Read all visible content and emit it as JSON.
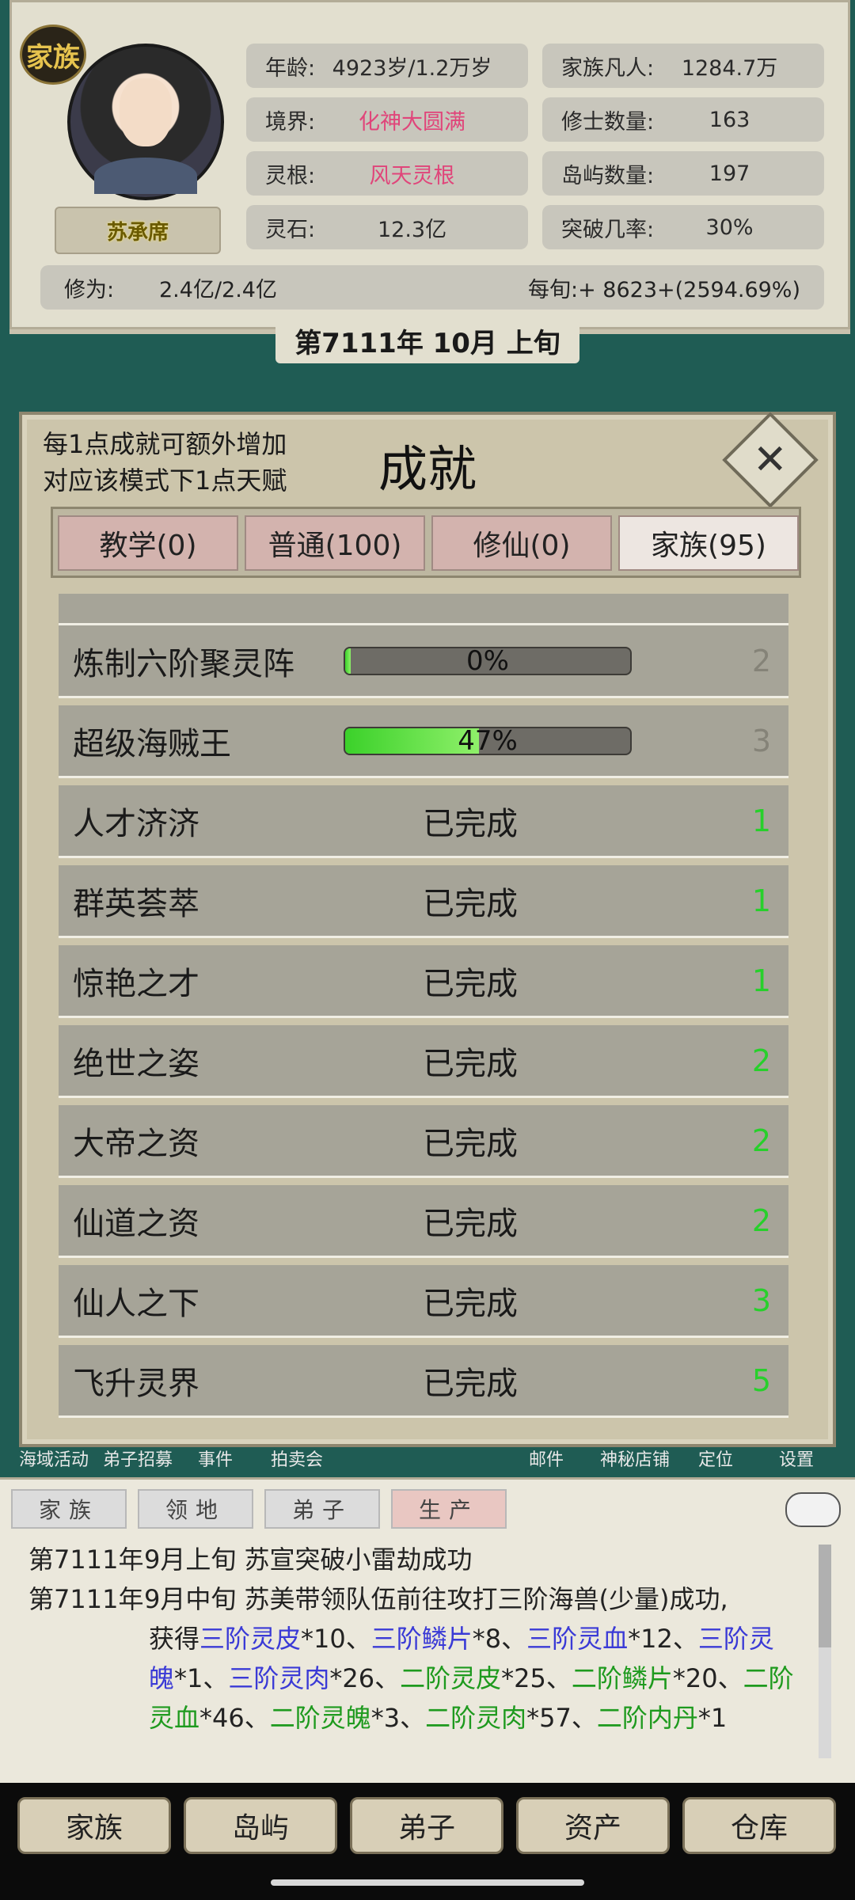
{
  "header": {
    "clan_badge": "家族",
    "character_name": "苏承席",
    "stats_left": [
      {
        "label": "年龄:",
        "value": "4923岁/1.2万岁",
        "highlight": false
      },
      {
        "label": "境界:",
        "value": "化神大圆满",
        "highlight": true
      },
      {
        "label": "灵根:",
        "value": "风天灵根",
        "highlight": true
      },
      {
        "label": "灵石:",
        "value": "12.3亿",
        "highlight": false
      }
    ],
    "stats_right": [
      {
        "label": "家族凡人:",
        "value": "1284.7万"
      },
      {
        "label": "修士数量:",
        "value": "163"
      },
      {
        "label": "岛屿数量:",
        "value": "197"
      },
      {
        "label": "突破几率:",
        "value": "30%"
      }
    ],
    "cultivation_label": "修为:",
    "cultivation_value": "2.4亿/2.4亿",
    "per_period": "每旬:+ 8623+(2594.69%)",
    "date": "第7111年 10月 上旬"
  },
  "dialog": {
    "hint_line1": "每1点成就可额外增加",
    "hint_line2": "对应该模式下1点天赋",
    "title": "成就",
    "tabs": [
      {
        "label": "教学(0)",
        "active": false
      },
      {
        "label": "普通(100)",
        "active": false
      },
      {
        "label": "修仙(0)",
        "active": false
      },
      {
        "label": "家族(95)",
        "active": true
      }
    ],
    "achievements": [
      {
        "name": "炼制六阶聚灵阵",
        "progress": 0,
        "progress_text": "0%",
        "points": "2",
        "done": false
      },
      {
        "name": "超级海贼王",
        "progress": 47,
        "progress_text": "47%",
        "points": "3",
        "done": false
      },
      {
        "name": "人才济济",
        "status": "已完成",
        "points": "1",
        "done": true
      },
      {
        "name": "群英荟萃",
        "status": "已完成",
        "points": "1",
        "done": true
      },
      {
        "name": "惊艳之才",
        "status": "已完成",
        "points": "1",
        "done": true
      },
      {
        "name": "绝世之姿",
        "status": "已完成",
        "points": "2",
        "done": true
      },
      {
        "name": "大帝之资",
        "status": "已完成",
        "points": "2",
        "done": true
      },
      {
        "name": "仙道之资",
        "status": "已完成",
        "points": "2",
        "done": true
      },
      {
        "name": "仙人之下",
        "status": "已完成",
        "points": "3",
        "done": true
      },
      {
        "name": "飞升灵界",
        "status": "已完成",
        "points": "5",
        "done": true
      }
    ]
  },
  "menu_strip": [
    "海域活动",
    "弟子招募",
    "事件",
    "拍卖会",
    "邮件",
    "神秘店铺",
    "定位",
    "设置"
  ],
  "log": {
    "tabs": [
      {
        "label": "家族",
        "active": false
      },
      {
        "label": "领地",
        "active": false
      },
      {
        "label": "弟子",
        "active": false
      },
      {
        "label": "生产",
        "active": true
      }
    ],
    "line1_date": "第7111年",
    "line1_text": "9月上旬 苏宣突破小雷劫成功",
    "line2_date": "第7111年",
    "line2_text": "9月中旬 苏美带领队伍前往攻打三阶海兽(少量)成功,",
    "line2_cont_prefix": "获得",
    "items": [
      {
        "name": "三阶灵皮",
        "qty": "*10",
        "tier": 3
      },
      {
        "name": "三阶鳞片",
        "qty": "*8",
        "tier": 3
      },
      {
        "name": "三阶灵血",
        "qty": "*12",
        "tier": 3
      },
      {
        "name": "三阶灵魄",
        "qty": "*1",
        "tier": 3
      },
      {
        "name": "三阶灵肉",
        "qty": "*26",
        "tier": 3
      },
      {
        "name": "二阶灵皮",
        "qty": "*25",
        "tier": 2
      },
      {
        "name": "二阶鳞片",
        "qty": "*20",
        "tier": 2
      },
      {
        "name": "二阶灵血",
        "qty": "*46",
        "tier": 2
      },
      {
        "name": "二阶灵魄",
        "qty": "*3",
        "tier": 2
      },
      {
        "name": "二阶灵肉",
        "qty": "*57",
        "tier": 2
      },
      {
        "name": "二阶内丹",
        "qty": "*1",
        "tier": 2
      }
    ]
  },
  "bottom_nav": [
    "家族",
    "岛屿",
    "弟子",
    "资产",
    "仓库"
  ]
}
